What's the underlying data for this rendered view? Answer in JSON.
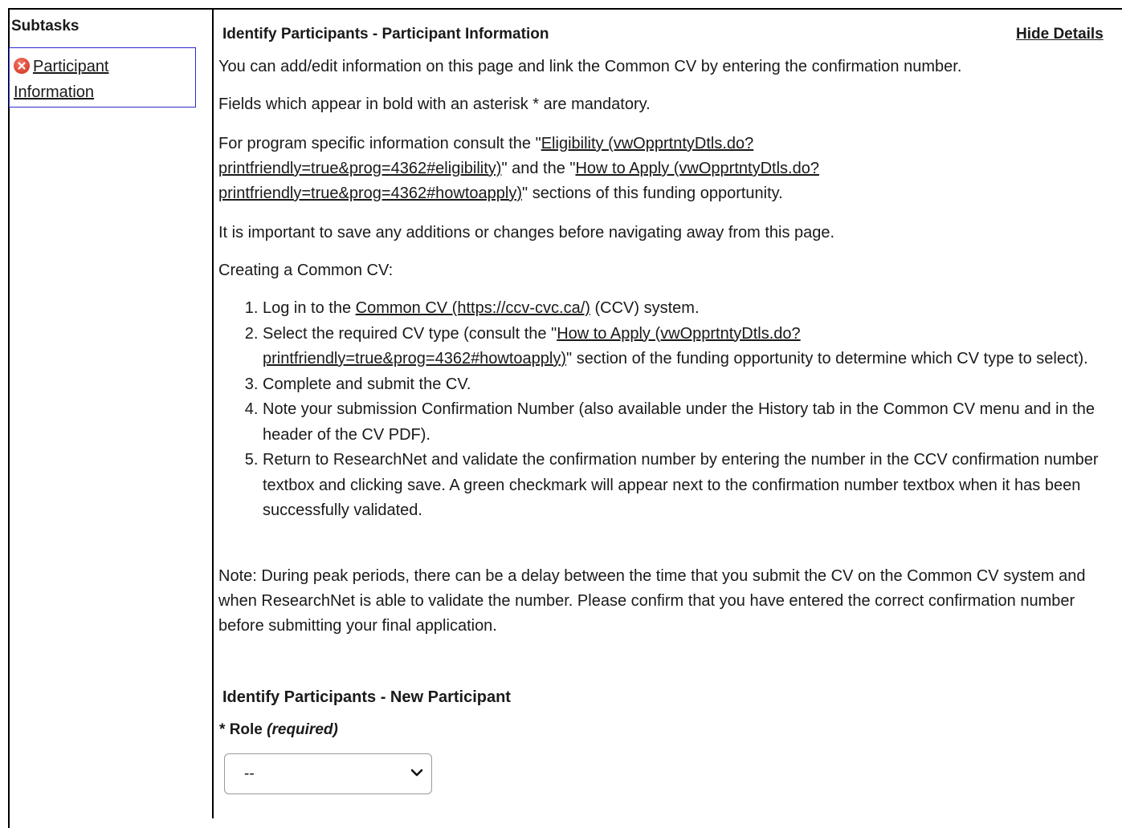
{
  "sidebar": {
    "title": "Subtasks",
    "subtask_line1": "Participant",
    "subtask_line2": "Information",
    "subtask_status_icon": "error-x-icon"
  },
  "main": {
    "title": "Identify Participants - Participant Information",
    "hide_details": "Hide Details",
    "intro": "You can add/edit information on this page and link the Common CV by entering the confirmation number.",
    "mandatory_note": "Fields which appear in bold with an asterisk * are mandatory.",
    "program_info": {
      "prefix": "For program specific information consult the \"",
      "eligibility_link_l1": "Eligibility (vwOpprtntyDtls.do?",
      "eligibility_link_l2": "printfriendly=true&prog=4362#eligibility)",
      "middle": "\" and the \"",
      "howto_link_l1": "How to Apply (vwOpprtntyDtls.do?",
      "howto_link_l2": "printfriendly=true&prog=4362#howtoapply)",
      "suffix": "\" sections of this funding opportunity."
    },
    "save_note": "It is important to save any additions or changes before navigating away from this page.",
    "ccv_heading": "Creating a Common CV:",
    "steps": {
      "s1_prefix": "Log in to the ",
      "s1_link": "Common CV (https://ccv-cvc.ca/)",
      "s1_suffix": " (CCV) system.",
      "s2_prefix": "Select the required CV type (consult the \"",
      "s2_link_l1": "How to Apply (vwOpprtntyDtls.do?",
      "s2_link_l2": "printfriendly=true&prog=4362#howtoapply)",
      "s2_suffix": "\" section of the funding opportunity to determine which CV type to select).",
      "s3": "Complete and submit the CV.",
      "s4": "Note your submission Confirmation Number (also available under the History tab in the Common CV menu and in the header of the CV PDF).",
      "s5": "Return to ResearchNet and validate the confirmation number by entering the number in the CCV confirmation number textbox and clicking save. A green checkmark will appear next to the confirmation number textbox when it has been successfully validated."
    },
    "peak_note": "Note: During peak periods, there can be a delay between the time that you submit the CV on the Common CV system and when ResearchNet is able to validate the number. Please confirm that you have entered the correct confirmation number before submitting your final application.",
    "new_participant": {
      "title": "Identify Participants - New Participant",
      "role_asterisk": "*",
      "role_label": "Role",
      "role_required": "(required)",
      "role_value": "--"
    }
  }
}
